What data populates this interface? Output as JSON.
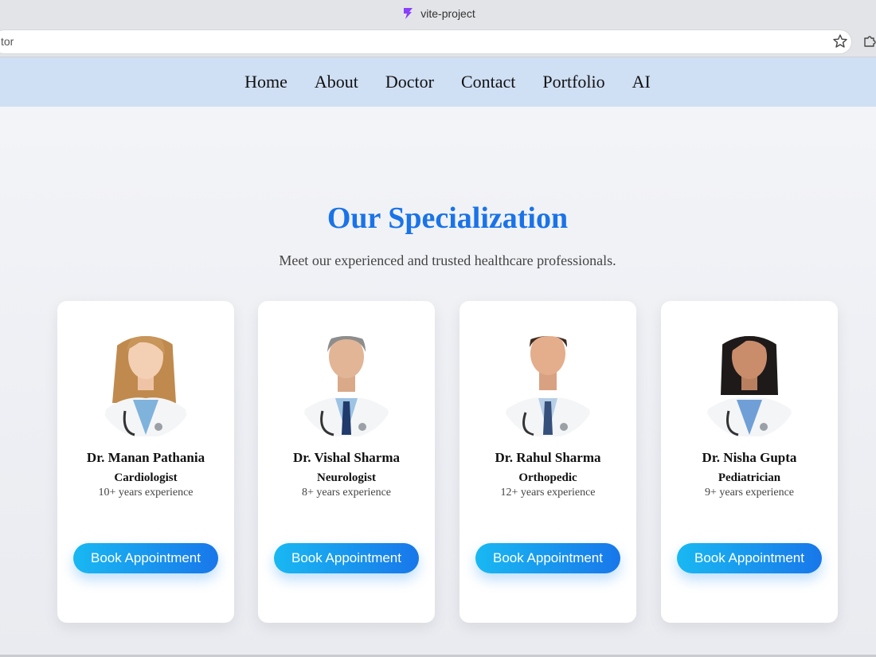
{
  "browser": {
    "tab_title": "vite-project",
    "address_text": "tor",
    "tab_icon": "vite-bolt-icon",
    "accent": "#8a3ffc"
  },
  "nav": {
    "items": [
      {
        "label": "Home"
      },
      {
        "label": "About"
      },
      {
        "label": "Doctor"
      },
      {
        "label": "Contact"
      },
      {
        "label": "Portfolio"
      },
      {
        "label": "AI"
      }
    ]
  },
  "section": {
    "title": "Our Specialization",
    "subtitle": "Meet our experienced and trusted healthcare professionals."
  },
  "doctors": [
    {
      "name": "Dr. Manan Pathania",
      "specialty": "Cardiologist",
      "experience": "10+ years experience",
      "button": "Book Appointment"
    },
    {
      "name": "Dr. Vishal Sharma",
      "specialty": "Neurologist",
      "experience": "8+ years experience",
      "button": "Book Appointment"
    },
    {
      "name": "Dr. Rahul Sharma",
      "specialty": "Orthopedic",
      "experience": "12+ years experience",
      "button": "Book Appointment"
    },
    {
      "name": "Dr. Nisha Gupta",
      "specialty": "Pediatrician",
      "experience": "9+ years experience",
      "button": "Book Appointment"
    }
  ],
  "colors": {
    "title": "#1a73e8",
    "nav_bg": "#cfdff4",
    "button_start": "#19b8f2",
    "button_end": "#1877ea"
  }
}
